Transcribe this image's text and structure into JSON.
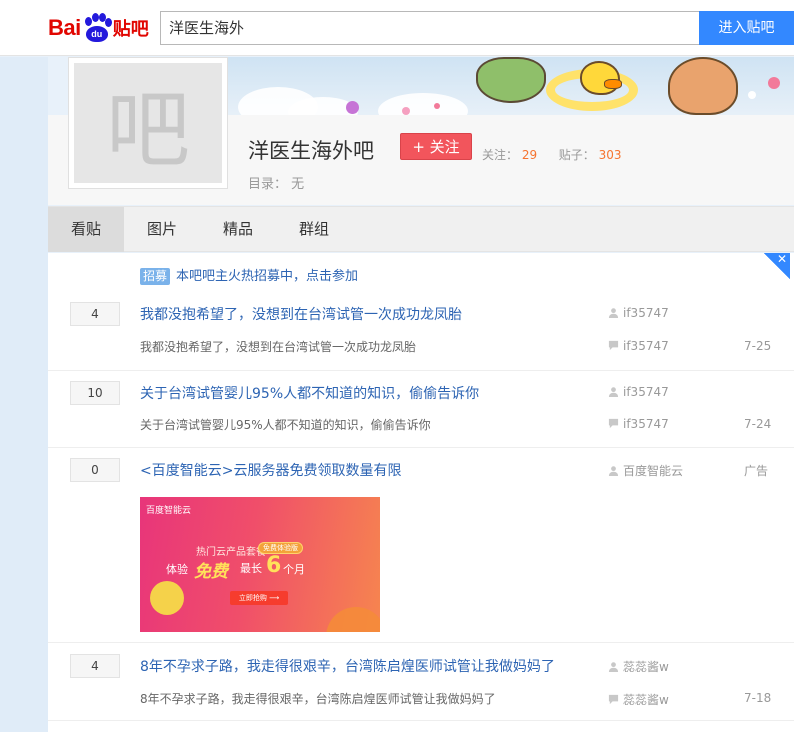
{
  "logo": {
    "bai": "Bai",
    "du": "du",
    "tieba": "贴吧"
  },
  "search": {
    "value": "洋医生海外",
    "button": "进入贴吧"
  },
  "forum": {
    "avatar_char": "吧",
    "name": "洋医生海外吧",
    "follow_label": "+ 关注",
    "follow_stat_label": "关注：",
    "follow_count": "29",
    "post_stat_label": "贴子：",
    "post_count": "303",
    "catalog_label": "目录：",
    "catalog_value": "无"
  },
  "tabs": [
    {
      "label": "看贴"
    },
    {
      "label": "图片"
    },
    {
      "label": "精品"
    },
    {
      "label": "群组"
    }
  ],
  "corner_icon": "close-icon",
  "recruit": {
    "badge": "招募",
    "text": "本吧吧主火热招募中，点击参加"
  },
  "threads": [
    {
      "reply": "4",
      "title": "我都没抱希望了，没想到在台湾试管一次成功龙凤胎",
      "abstract": "我都没抱希望了，没想到在台湾试管一次成功龙凤胎",
      "author": "if35747",
      "last_reply": "if35747",
      "date": "7-25"
    },
    {
      "reply": "10",
      "title": "关于台湾试管婴儿95%人都不知道的知识，偷偷告诉你",
      "abstract": "关于台湾试管婴儿95%人都不知道的知识，偷偷告诉你",
      "author": "if35747",
      "last_reply": "if35747",
      "date": "7-24"
    },
    {
      "reply": "4",
      "title": "8年不孕求子路，我走得很艰辛，台湾陈启煌医师试管让我做妈妈了",
      "abstract": "8年不孕求子路，我走得很艰辛，台湾陈启煌医师试管让我做妈妈了",
      "author": "蕊蕊酱w",
      "last_reply": "蕊蕊酱w",
      "date": "7-18"
    }
  ],
  "ad": {
    "reply": "0",
    "title": "<百度智能云>云服务器免费领取数量有限",
    "author": "百度智能云",
    "tag": "广告",
    "image": {
      "logo": "百度智能云",
      "line1": "热门云产品套餐",
      "chip": "免费体验版",
      "line2": "体验",
      "free": "免费",
      "line3": "最长",
      "six": "6",
      "line4": "个月",
      "cta": "立即抢购 ⟶"
    }
  },
  "icons": {
    "author": "user-icon",
    "last_reply": "comment-icon"
  }
}
